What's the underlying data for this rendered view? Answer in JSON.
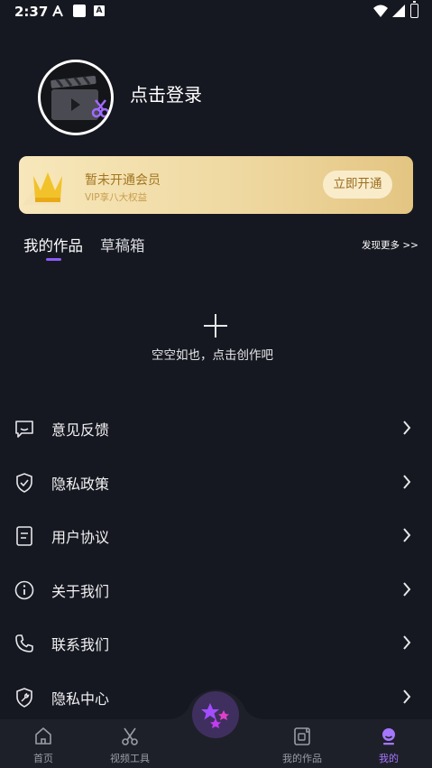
{
  "status_bar": {
    "time": "2:37",
    "icons": [
      "a-logo-icon",
      "square-notification-icon",
      "a-box-icon",
      "wifi-icon",
      "signal-icon",
      "battery-icon"
    ]
  },
  "profile": {
    "avatar_icon": "clapperboard-scissors-icon",
    "login_label": "点击登录"
  },
  "vip": {
    "title": "暂未开通会员",
    "subtitle": "VIP享八大权益",
    "button_label": "立即开通",
    "icon": "crown-icon"
  },
  "tabs": {
    "items": [
      {
        "label": "我的作品",
        "active": true
      },
      {
        "label": "草稿箱",
        "active": false
      }
    ],
    "more_label": "发现更多 >>"
  },
  "empty_state": {
    "icon": "plus-icon",
    "text": "空空如也，点击创作吧"
  },
  "menu": {
    "items": [
      {
        "label": "意见反馈",
        "icon": "feedback-icon"
      },
      {
        "label": "隐私政策",
        "icon": "shield-check-icon"
      },
      {
        "label": "用户协议",
        "icon": "document-icon"
      },
      {
        "label": "关于我们",
        "icon": "info-icon"
      },
      {
        "label": "联系我们",
        "icon": "phone-icon"
      },
      {
        "label": "隐私中心",
        "icon": "shield-wrench-icon"
      }
    ]
  },
  "bottom_nav": {
    "items": [
      {
        "label": "首页",
        "icon": "home-icon",
        "active": false
      },
      {
        "label": "视频工具",
        "icon": "scissors-icon",
        "active": false
      },
      {
        "label": "我的作品",
        "icon": "video-file-icon",
        "active": false
      },
      {
        "label": "我的",
        "icon": "user-icon",
        "active": true
      }
    ],
    "center_icon": "stars-create-icon"
  },
  "colors": {
    "background": "#161821",
    "accent": "#8c5bf7",
    "vip_gold": "#a27521"
  }
}
